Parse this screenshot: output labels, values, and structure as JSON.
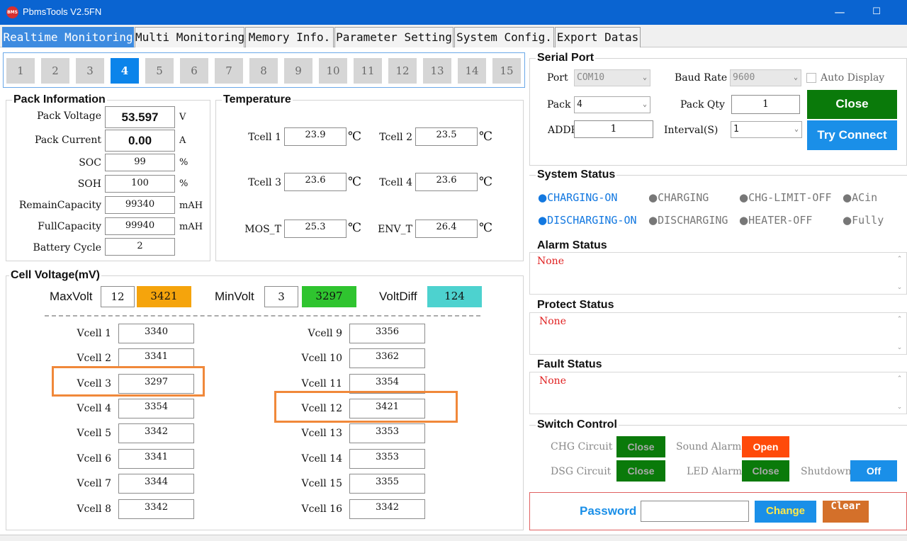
{
  "titlebar": {
    "app_logo": "BMS",
    "app_title": "PbmsTools V2.5FN",
    "minimize": "—",
    "maximize": "☐"
  },
  "tabs": [
    {
      "label": "Realtime Monitoring"
    },
    {
      "label": "Multi Monitoring"
    },
    {
      "label": "Memory Info."
    },
    {
      "label": "Parameter Setting"
    },
    {
      "label": "System Config."
    },
    {
      "label": "Export Datas"
    }
  ],
  "pack_tabs": [
    "1",
    "2",
    "3",
    "4",
    "5",
    "6",
    "7",
    "8",
    "9",
    "10",
    "11",
    "12",
    "13",
    "14",
    "15"
  ],
  "pack_info": {
    "title": "Pack Information",
    "voltage_label": "Pack Voltage",
    "voltage": "53.597",
    "voltage_unit": "V",
    "current_label": "Pack Current",
    "current": "0.00",
    "current_unit": "A",
    "soc_label": "SOC",
    "soc": "99",
    "soc_unit": "%",
    "soh_label": "SOH",
    "soh": "100",
    "soh_unit": "%",
    "remain_label": "RemainCapacity",
    "remain": "99340",
    "remain_unit": "mAH",
    "full_label": "FullCapacity",
    "full": "99940",
    "full_unit": "mAH",
    "cycle_label": "Battery Cycle",
    "cycle": "2"
  },
  "temperature": {
    "title": "Temperature",
    "tcell1_label": "Tcell 1",
    "tcell1": "23.9",
    "tcell2_label": "Tcell 2",
    "tcell2": "23.5",
    "tcell3_label": "Tcell 3",
    "tcell3": "23.6",
    "tcell4_label": "Tcell 4",
    "tcell4": "23.6",
    "mos_label": "MOS_T",
    "mos": "25.3",
    "env_label": "ENV_T",
    "env": "26.4",
    "unit": "℃"
  },
  "cell_voltage": {
    "title": "Cell Voltage(mV)",
    "max_label": "MaxVolt",
    "max_cell": "12",
    "max_value": "3421",
    "min_label": "MinVolt",
    "min_cell": "3",
    "min_value": "3297",
    "diff_label": "VoltDiff",
    "diff_value": "124",
    "cells": [
      {
        "label": "Vcell 1",
        "value": "3340"
      },
      {
        "label": "Vcell 2",
        "value": "3341"
      },
      {
        "label": "Vcell 3",
        "value": "3297"
      },
      {
        "label": "Vcell 4",
        "value": "3354"
      },
      {
        "label": "Vcell 5",
        "value": "3342"
      },
      {
        "label": "Vcell 6",
        "value": "3341"
      },
      {
        "label": "Vcell 7",
        "value": "3344"
      },
      {
        "label": "Vcell 8",
        "value": "3342"
      },
      {
        "label": "Vcell 9",
        "value": "3356"
      },
      {
        "label": "Vcell 10",
        "value": "3362"
      },
      {
        "label": "Vcell 11",
        "value": "3354"
      },
      {
        "label": "Vcell 12",
        "value": "3421"
      },
      {
        "label": "Vcell 13",
        "value": "3353"
      },
      {
        "label": "Vcell 14",
        "value": "3353"
      },
      {
        "label": "Vcell 15",
        "value": "3355"
      },
      {
        "label": "Vcell 16",
        "value": "3342"
      }
    ]
  },
  "serial_port": {
    "title": "Serial Port",
    "port_label": "Port",
    "port": "COM10",
    "baud_label": "Baud Rate",
    "baud": "9600",
    "auto_display": "Auto Display",
    "pack_label": "Pack",
    "pack": "4",
    "pack_qty_label": "Pack Qty",
    "pack_qty": "1",
    "addr_label": "ADDR",
    "addr": "1",
    "interval_label": "Interval(S)",
    "interval": "1",
    "close_label": "Close",
    "connect_label": "Try Connect",
    "arrow": "⌄"
  },
  "system_status": {
    "title": "System Status",
    "dot": "●",
    "items": [
      {
        "label": "CHARGING-ON"
      },
      {
        "label": "CHARGING"
      },
      {
        "label": "CHG-LIMIT-OFF"
      },
      {
        "label": "ACin"
      },
      {
        "label": "DISCHARGING-ON"
      },
      {
        "label": "DISCHARGING"
      },
      {
        "label": "HEATER-OFF"
      },
      {
        "label": "Fully"
      }
    ]
  },
  "alarm_status": {
    "title": "Alarm Status",
    "text": "None"
  },
  "protect_status": {
    "title": "Protect Status",
    "text": "None"
  },
  "fault_status": {
    "title": "Fault Status",
    "text": "None"
  },
  "scroll": {
    "up": "⌃",
    "down": "⌄"
  },
  "switch_control": {
    "title": "Switch Control",
    "chg_label": "CHG Circuit",
    "chg": "Close",
    "sound_label": "Sound Alarm",
    "sound": "Open",
    "dsg_label": "DSG Circuit",
    "dsg": "Close",
    "led_label": "LED Alarm",
    "led": "Close",
    "shutdown_label": "Shutdown",
    "shutdown": "Off"
  },
  "password": {
    "label": "Password",
    "value": "",
    "change_label": "Change",
    "clear_label": "Clear"
  },
  "colors": {
    "max": "#f5a40c",
    "min": "#2fc42f",
    "diff": "#4dd2cf",
    "green_btn": "#0a7a0a",
    "blue_btn": "#1a8fe8",
    "accent": "#0a64d1"
  }
}
